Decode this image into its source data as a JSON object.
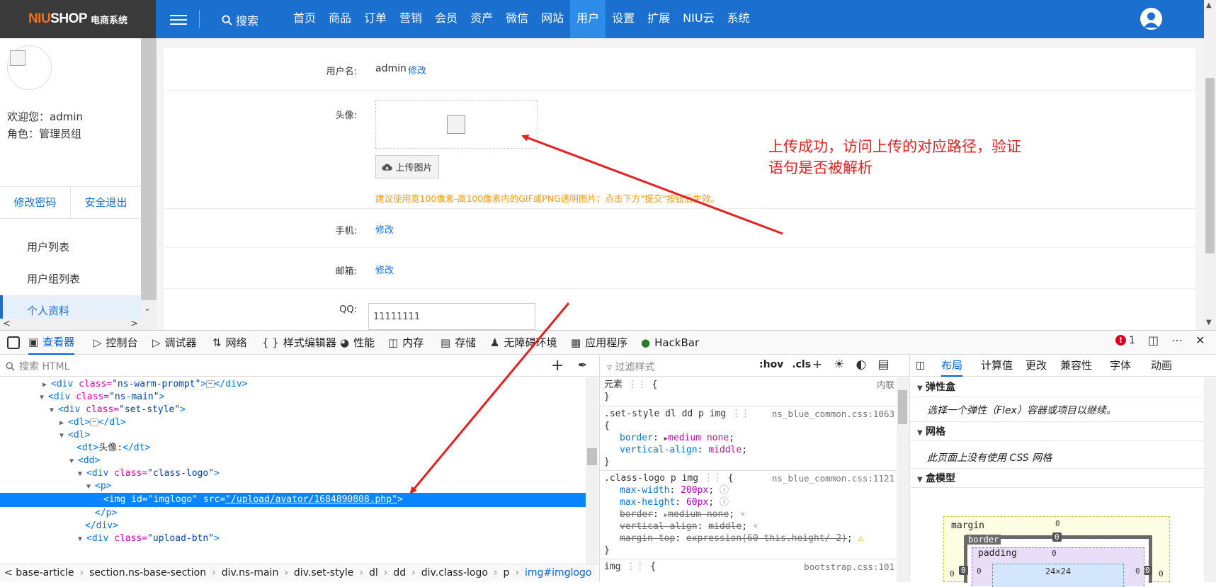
{
  "topnav": {
    "logo_main_a": "NIU",
    "logo_main_b": "SHOP",
    "logo_sub": "电商系统",
    "search_label": "搜索",
    "links": [
      "首页",
      "商品",
      "订单",
      "营销",
      "会员",
      "资产",
      "微信",
      "网站",
      "用户",
      "设置",
      "扩展",
      "NIU云",
      "系统"
    ],
    "active_link": "用户"
  },
  "sidebar": {
    "welcome": "欢迎您：admin",
    "role": "角色：管理员组",
    "change_password": "修改密码",
    "logout": "安全退出",
    "items": [
      {
        "label": "用户列表"
      },
      {
        "label": "用户组列表"
      },
      {
        "label": "个人资料",
        "active": true
      }
    ]
  },
  "profile": {
    "username_label": "用户名:",
    "username_value": "admin",
    "username_edit": "修改",
    "avatar_label": "头像:",
    "upload_button": "上传图片",
    "upload_tip": "建议使用宽100像素-高100像素内的GIF或PNG透明图片；点击下方\"提交\"按钮后生效。",
    "phone_label": "手机:",
    "phone_edit": "修改",
    "email_label": "邮箱:",
    "email_edit": "修改",
    "qq_label": "QQ:",
    "qq_value": "11111111"
  },
  "annotation": {
    "line1": "上传成功，访问上传的对应路径，验证",
    "line2": "语句是否被解析",
    "color": "#e52020"
  },
  "devtools": {
    "tabs": [
      "查看器",
      "控制台",
      "调试器",
      "网络",
      "样式编辑器",
      "性能",
      "内存",
      "存储",
      "无障碍环境",
      "应用程序",
      "HackBar"
    ],
    "active_tab": "查看器",
    "error_count": "1",
    "search_placeholder": "搜索 HTML",
    "tree": {
      "l1_tag_open": "<div ",
      "l1_attr": "class=",
      "l1_val": "\"ns-warm-prompt\"",
      "l1_close": "></div>",
      "l2_attr": "class=",
      "l2_val": "\"ns-main\"",
      "l3_val": "\"set-style\"",
      "l4": "<dl>",
      "l4_close": "</dl>",
      "l5": "<dl>",
      "l6_dt_open": "<dt>",
      "l6_text": "头像:",
      "l6_dt_close": "</dt>",
      "l7": "<dd>",
      "l8_val": "\"class-logo\"",
      "l9": "<p>",
      "l10_id_attr": "id=",
      "l10_id_val": "\"imglogo\"",
      "l10_src_attr": "src=",
      "l10_src_val": "\"/upload/avator/1684890808.php\"",
      "l11": "</p>",
      "l12": "</div>",
      "l13_val": "\"upload-btn\""
    },
    "breadcrumbs": [
      "base-article",
      "section.ns-base-section",
      "div.ns-main",
      "div.set-style",
      "dl",
      "dd",
      "div.class-logo",
      "p",
      "img#imglogo"
    ],
    "rules": {
      "filter_placeholder": "过滤样式",
      "hov": ":hov",
      "cls": ".cls",
      "element_sel": "元素",
      "inline": "内联",
      "r1_sel": ".set-style dl dd p img",
      "r1_src": "ns_blue_common.css:1063",
      "r1_p1": "border",
      "r1_v1": "medium none",
      "r1_p2": "vertical-align",
      "r1_v2": "middle",
      "r2_sel": ".class-logo p img",
      "r2_src": "ns_blue_common.css:1121",
      "r2_p1": "max-width",
      "r2_v1": "200px",
      "r2_p2": "max-height",
      "r2_v2": "60px",
      "r2_p3": "border",
      "r2_v3": "medium none",
      "r2_p4": "vertical-align",
      "r2_v4": "middle",
      "r2_p5": "margin-top",
      "r2_v5": "expression(60-this.height/ 2)",
      "r3_sel": "img",
      "r3_src": "bootstrap.css:101"
    },
    "layout_tabs": [
      "布局",
      "计算值",
      "更改",
      "兼容性",
      "字体",
      "动画"
    ],
    "layout_active": "布局",
    "flex_title": "弹性盒",
    "flex_body": "选择一个弹性（Flex）容器或项目以继续。",
    "grid_title": "网格",
    "grid_body": "此页面上没有使用 CSS 网格",
    "box_title": "盒模型",
    "box": {
      "margin": "margin",
      "border": "border",
      "padding": "padding",
      "content": "24×24",
      "zero": "0"
    }
  }
}
